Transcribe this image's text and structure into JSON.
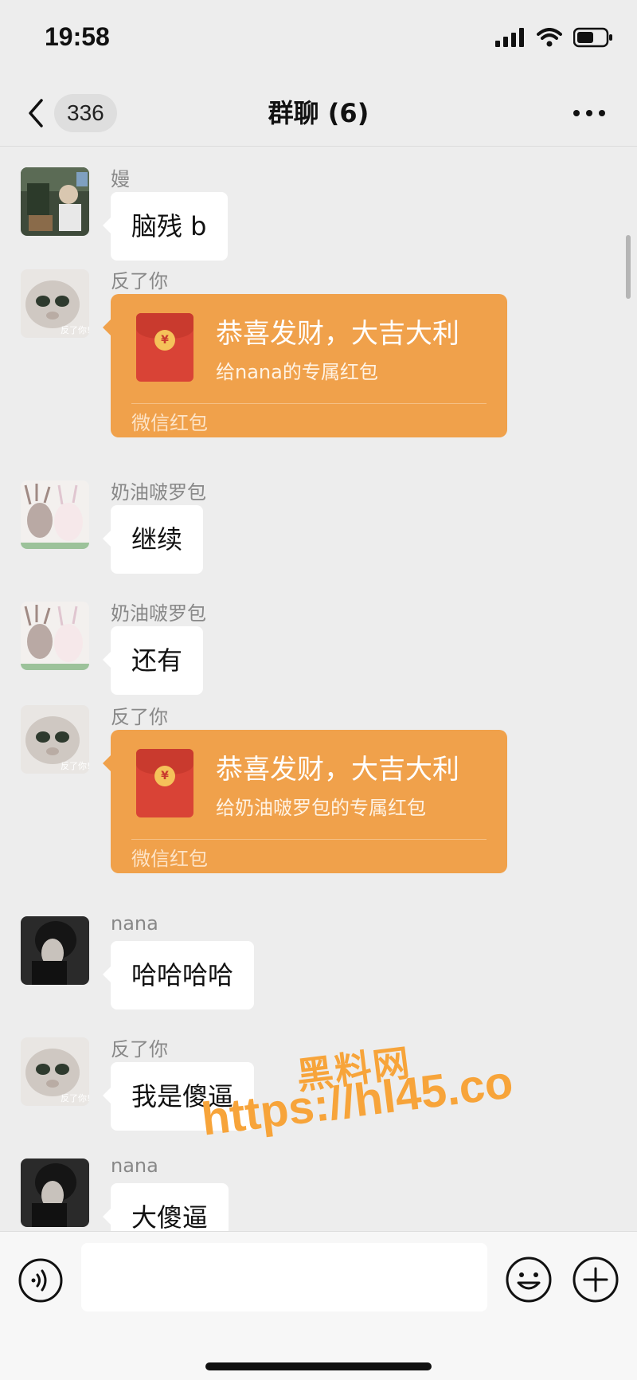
{
  "status_bar": {
    "time": "19:58"
  },
  "nav": {
    "unread": "336",
    "title": "群聊 (6)"
  },
  "messages": [
    {
      "sender": "嫚",
      "type": "text",
      "text": "脑残 b"
    },
    {
      "sender": "反了你",
      "type": "redpacket",
      "title": "恭喜发财，大吉大利",
      "subtitle": "给nana的专属红包",
      "footer": "微信红包"
    },
    {
      "sender": "奶油啵罗包",
      "type": "text",
      "text": "继续"
    },
    {
      "sender": "奶油啵罗包",
      "type": "text",
      "text": "还有"
    },
    {
      "sender": "反了你",
      "type": "redpacket",
      "title": "恭喜发财，大吉大利",
      "subtitle": "给奶油啵罗包的专属红包",
      "footer": "微信红包"
    },
    {
      "sender": "nana",
      "type": "text",
      "text": "哈哈哈哈"
    },
    {
      "sender": "反了你",
      "type": "text",
      "text": "我是傻逼"
    },
    {
      "sender": "nana",
      "type": "text",
      "text": "大傻逼"
    }
  ],
  "avatar_labels": {
    "fanleni": "反了你!"
  },
  "watermark": {
    "line1": "黑料网",
    "line2": "https://hl45.co"
  },
  "colors": {
    "background": "#ededed",
    "redpacket": "#f0a14b",
    "watermark": "#f7a43a"
  }
}
